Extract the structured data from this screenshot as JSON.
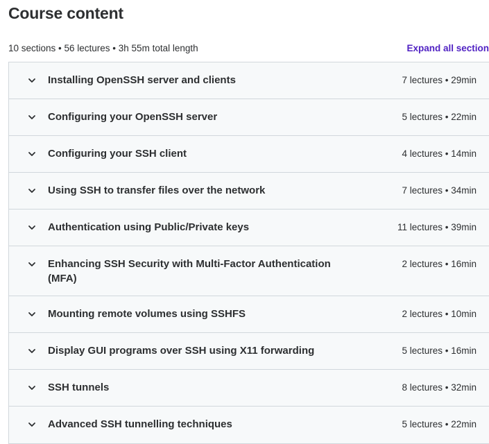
{
  "page": {
    "title": "Course content"
  },
  "summary": {
    "text": "10 sections • 56 lectures • 3h 55m total length",
    "expand_label": "Expand all section"
  },
  "sections": [
    {
      "title": "Installing OpenSSH server and clients",
      "meta": "7 lectures • 29min"
    },
    {
      "title": "Configuring your OpenSSH server",
      "meta": "5 lectures • 22min"
    },
    {
      "title": "Configuring your SSH client",
      "meta": "4 lectures • 14min"
    },
    {
      "title": "Using SSH to transfer files over the network",
      "meta": "7 lectures • 34min"
    },
    {
      "title": "Authentication using Public/Private keys",
      "meta": "11 lectures • 39min"
    },
    {
      "title": "Enhancing SSH Security with Multi-Factor Authentication (MFA)",
      "meta": "2 lectures • 16min"
    },
    {
      "title": "Mounting remote volumes using SSHFS",
      "meta": "2 lectures • 10min"
    },
    {
      "title": "Display GUI programs over SSH using X11 forwarding",
      "meta": "5 lectures • 16min"
    },
    {
      "title": "SSH tunnels",
      "meta": "8 lectures • 32min"
    },
    {
      "title": "Advanced SSH tunnelling techniques",
      "meta": "5 lectures • 22min"
    }
  ],
  "icons": {
    "chevron": "chevron-down-icon"
  },
  "colors": {
    "text": "#2d2f31",
    "accent": "#5022c3",
    "row_bg": "#f7f9fa",
    "border": "#d1d7dc"
  }
}
